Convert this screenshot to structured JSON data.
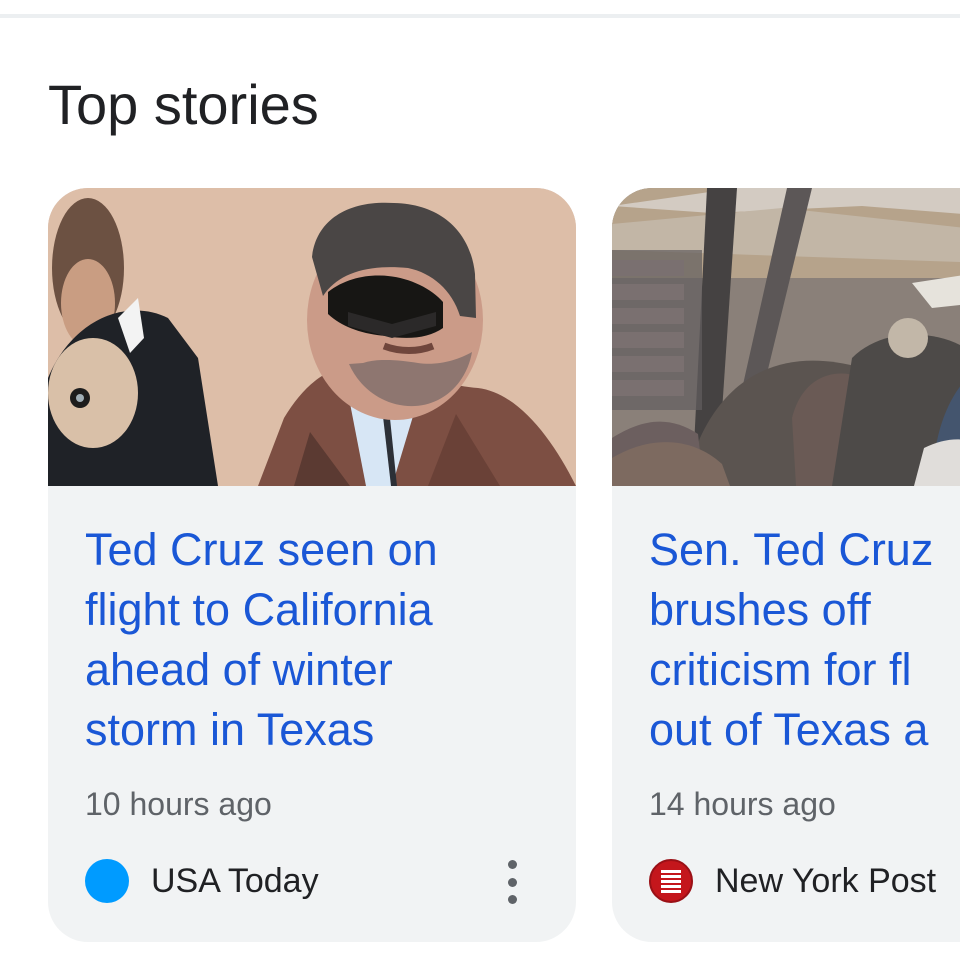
{
  "section": {
    "title": "Top stories"
  },
  "stories": [
    {
      "headline": "Ted Cruz seen on\nflight to California\nahead of winter\nstorm in Texas",
      "time": "10 hours ago",
      "source": "USA Today",
      "source_logo_color": "#009bff"
    },
    {
      "headline": "Sen. Ted Cruz\nbrushes off\ncriticism for fl\nout of Texas a",
      "time": "14 hours ago",
      "source": "New York Post",
      "source_logo_color": "#c4161c"
    }
  ],
  "colors": {
    "headline": "#1a57d6",
    "card_background": "#f1f3f4",
    "secondary_text": "#5f6368"
  },
  "icons": {
    "more": "more-vert-icon"
  }
}
